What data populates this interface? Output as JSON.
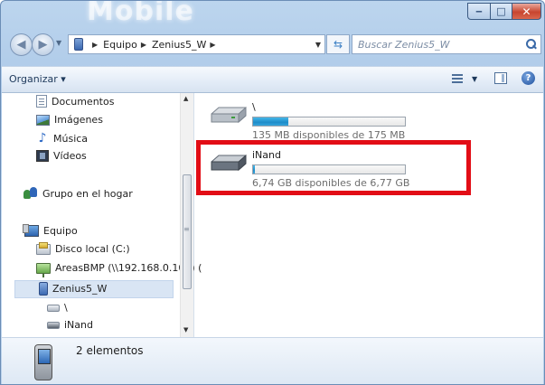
{
  "window": {
    "watermark": "Mobile",
    "controls": {
      "minimize": "‒",
      "maximize": "□",
      "close": "✕"
    }
  },
  "address": {
    "crumbs": [
      "Equipo",
      "Zenius5_W"
    ]
  },
  "search": {
    "placeholder": "Buscar Zenius5_W"
  },
  "toolbar": {
    "organize": "Organizar ▾",
    "help": "?"
  },
  "sidebar": {
    "items": [
      {
        "label": "Documentos",
        "icon": "document-icon"
      },
      {
        "label": "Imágenes",
        "icon": "pictures-icon"
      },
      {
        "label": "Música",
        "icon": "music-icon"
      },
      {
        "label": "Vídeos",
        "icon": "video-icon"
      },
      {
        "label": "Grupo en el hogar",
        "icon": "homegroup-icon"
      },
      {
        "label": "Equipo",
        "icon": "computer-icon"
      },
      {
        "label": "Disco local (C:)",
        "icon": "local-disk-icon"
      },
      {
        "label": "AreasBMP (\\\\192.168.0.100) (",
        "icon": "network-drive-icon"
      },
      {
        "label": "Zenius5_W",
        "icon": "device-icon",
        "selected": true
      },
      {
        "label": "\\",
        "icon": "drive-icon"
      },
      {
        "label": "iNand",
        "icon": "drive-icon"
      }
    ]
  },
  "drives": [
    {
      "name": "\\",
      "info": "135 MB disponibles de 175 MB",
      "used_fraction": 0.23
    },
    {
      "name": "iNand",
      "info": "6,74 GB disponibles de 6,77 GB",
      "used_fraction": 0.01
    }
  ],
  "details": {
    "count": "2 elementos"
  },
  "colors": {
    "highlight": "#e20d16",
    "bar_fill": "#1f8cc9",
    "selection": "#d9e5f4"
  }
}
